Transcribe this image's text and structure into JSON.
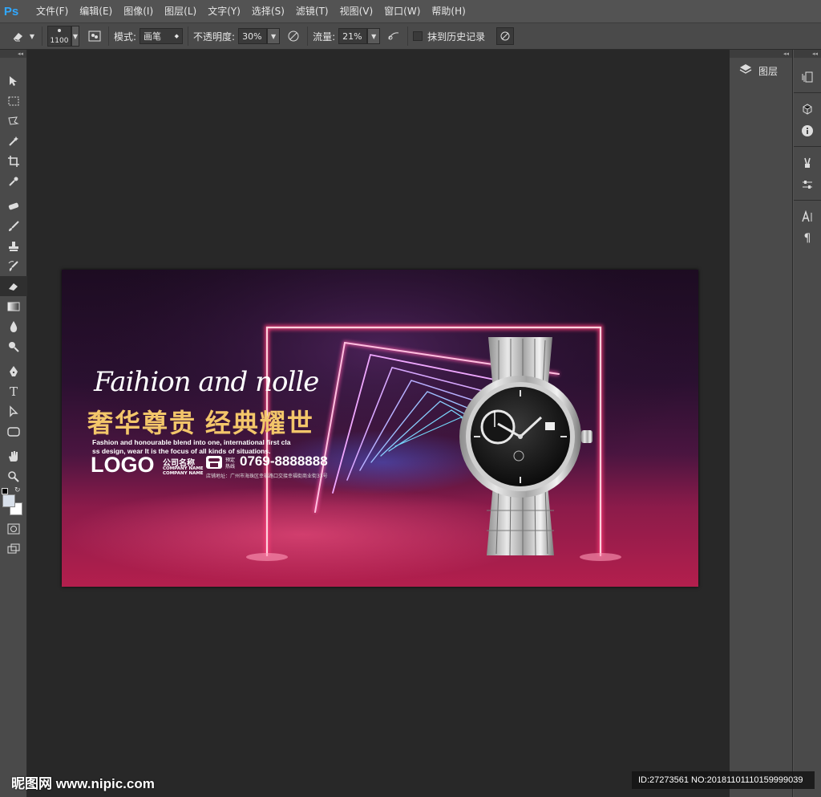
{
  "app": {
    "logo": "Ps"
  },
  "menu": [
    "文件(F)",
    "编辑(E)",
    "图像(I)",
    "图层(L)",
    "文字(Y)",
    "选择(S)",
    "滤镜(T)",
    "视图(V)",
    "窗口(W)",
    "帮助(H)"
  ],
  "options": {
    "brush_size": "1100",
    "mode_label": "模式:",
    "mode_value": "画笔",
    "opacity_label": "不透明度:",
    "opacity_value": "30%",
    "flow_label": "流量:",
    "flow_value": "21%",
    "erase_history_label": "抹到历史记录"
  },
  "panels": {
    "layers_tab": "图层"
  },
  "artwork": {
    "slogan_script": "Faihion and nolle",
    "slogan_main": "奢华尊贵 经典耀世",
    "slogan_en_line1": "Fashion and honourable blend into one, international first cla",
    "slogan_en_line2": "ss design, wear It is the focus of all kinds of situations.",
    "logo": "LOGO",
    "company_cn": "公司名称",
    "company_en1": "COMPANY NAME",
    "company_en2": "COMPANY NAME",
    "hotline1": "预定",
    "hotline2": "热线",
    "phone": "0769-8888888",
    "address": "店铺地址：广州市海珠区幸福路口交接幸福街商业街33号",
    "accent_color": "#f3c66a",
    "neon_color": "#ff3d7a"
  },
  "watermark": {
    "site": "昵图网 www.nipic.com",
    "id": "ID:27273561 NO:20181101110159999039"
  }
}
